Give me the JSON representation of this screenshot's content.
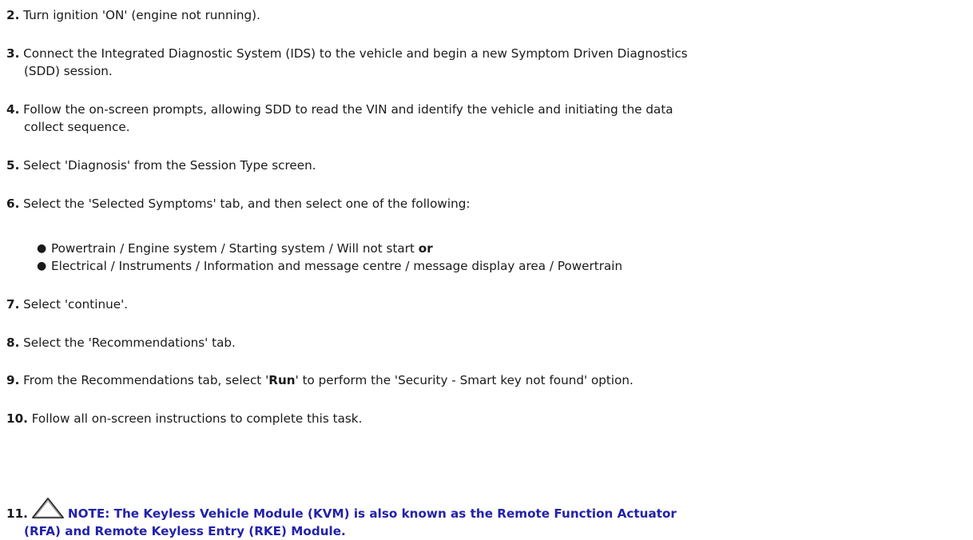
{
  "steps": [
    {
      "num": "2.",
      "text": "Turn ignition 'ON' (engine not running)."
    },
    {
      "num": "3.",
      "text_line1": "Connect the Integrated Diagnostic System (IDS) to the vehicle and begin a new Symptom Driven Diagnostics",
      "text_line2": "(SDD) session."
    },
    {
      "num": "4.",
      "text_line1": "Follow the on-screen prompts, allowing SDD to read the VIN and identify the vehicle and initiating the data",
      "text_line2": "collect sequence."
    },
    {
      "num": "5.",
      "text": "Select 'Diagnosis' from the Session Type screen."
    },
    {
      "num": "6.",
      "text": "Select the 'Selected Symptoms' tab, and then select one of the following:"
    },
    {
      "num": "7.",
      "text": "Select 'continue'."
    },
    {
      "num": "8.",
      "text": "Select the 'Recommendations' tab."
    },
    {
      "num": "9.",
      "text_before": "From the Recommendations tab, select '",
      "bold": "Run",
      "text_after": "' to perform the 'Security - Smart key not found' option."
    },
    {
      "num": "10.",
      "text": "Follow all on-screen instructions to complete this task."
    }
  ],
  "bullets": [
    {
      "text": "Powertrain / Engine system / Starting system / Will not start ",
      "bold": "or"
    },
    {
      "text": "Electrical / Instruments / Information and message centre / message display area / Powertrain"
    }
  ],
  "bullet_symbol": "●",
  "note": {
    "num": "11.",
    "icon": "warning-triangle-icon",
    "line1": "NOTE: The Keyless Vehicle Module (KVM) is also known as the Remote Function Actuator",
    "line2": "(RFA) and Remote Keyless Entry (RKE) Module.",
    "color": "#2222aa"
  }
}
